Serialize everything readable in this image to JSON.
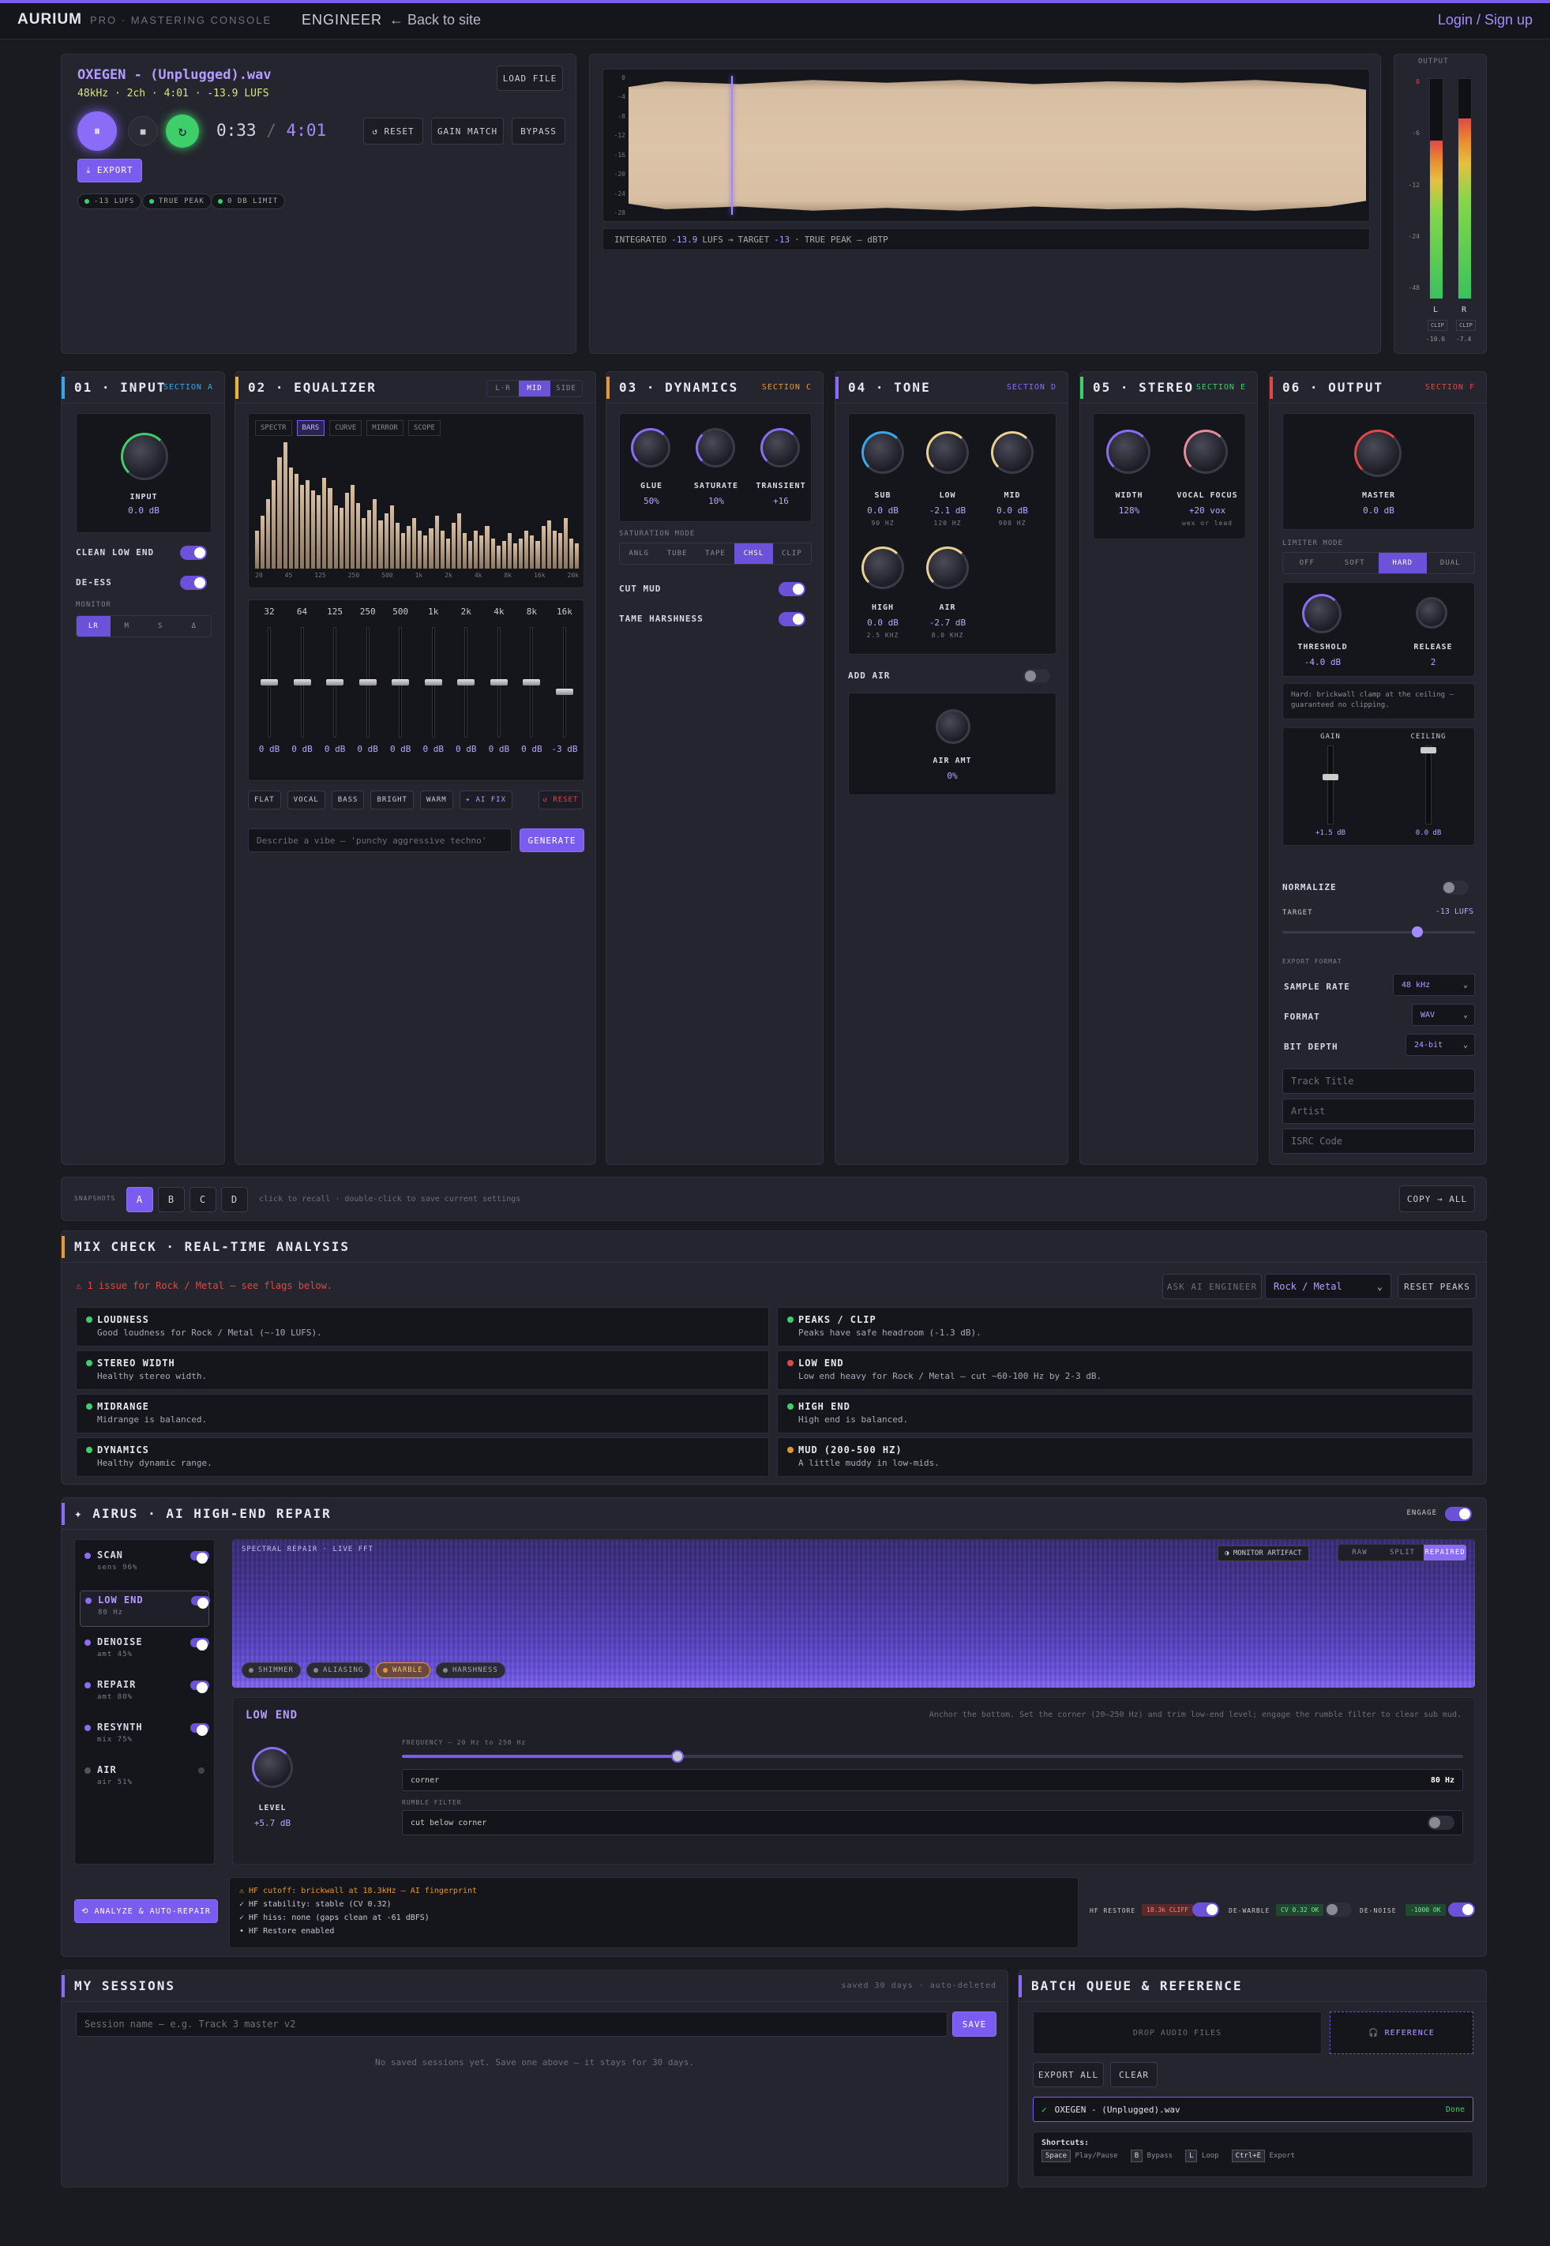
{
  "topbar": {
    "brand": "AURIUM",
    "subtitle": "PRO · MASTERING CONSOLE",
    "mode": "ENGINEER",
    "back": "← Back to site",
    "login": "Login / Sign up"
  },
  "player": {
    "filename": "OXEGEN - (Unplugged).wav",
    "meta": "48kHz · 2ch · 4:01 · -13.9 LUFS",
    "load": "LOAD FILE",
    "time_current": "0:33",
    "time_sep": "/",
    "time_total": "4:01",
    "reset": "↺ RESET",
    "gain_match": "GAIN MATCH",
    "bypass": "BYPASS",
    "export": "⤓ EXPORT",
    "badges": [
      "-13 LUFS",
      "TRUE PEAK",
      "0 DB LIMIT"
    ]
  },
  "waveform": {
    "y_ticks": [
      "0",
      "-4",
      "-8",
      "-12",
      "-16",
      "-20",
      "-24",
      "-28"
    ],
    "integrated_label": "INTEGRATED",
    "integrated": "-13.9",
    "lufs": "LUFS",
    "arrow": "→",
    "target_label": "TARGET",
    "target": "-13",
    "sep": "·",
    "true_peak": "TRUE PEAK — dBTP"
  },
  "meters": {
    "title": "OUTPUT",
    "ticks": [
      "0",
      "-6",
      "-12",
      "-24",
      "-48"
    ],
    "left": "L",
    "right": "R",
    "clip": "CLIP",
    "left_val": "-10.6",
    "right_val": "-7.4",
    "left_level": 0.72,
    "right_level": 0.82
  },
  "input": {
    "title": "01 · INPUT",
    "section": "SECTION A",
    "knob_label": "INPUT",
    "knob_value": "0.0 dB",
    "clean_low_end": "CLEAN LOW END",
    "de_ess": "DE-ESS",
    "monitor": "MONITOR",
    "monitor_opts": [
      "LR",
      "M",
      "S",
      "Δ"
    ]
  },
  "eq": {
    "title": "02 · EQUALIZER",
    "modes": [
      "L·R",
      "MID",
      "SIDE"
    ],
    "views": [
      "SPECTR",
      "BARS",
      "CURVE",
      "MIRROR",
      "SCOPE"
    ],
    "freq_axis": [
      "20",
      "45",
      "125",
      "250",
      "500",
      "1k",
      "2k",
      "4k",
      "8k",
      "16k",
      "20k"
    ],
    "bands": [
      "32",
      "64",
      "125",
      "250",
      "500",
      "1k",
      "2k",
      "4k",
      "8k",
      "16k"
    ],
    "gains": [
      "0 dB",
      "0 dB",
      "0 dB",
      "0 dB",
      "0 dB",
      "0 dB",
      "0 dB",
      "0 dB",
      "0 dB",
      "-3 dB"
    ],
    "presets": [
      "FLAT",
      "VOCAL",
      "BASS",
      "BRIGHT",
      "WARM",
      "✦ AI FIX"
    ],
    "reset": "↺ RESET",
    "vibe_placeholder": "Describe a vibe — 'punchy aggressive techno'",
    "generate": "GENERATE"
  },
  "dynamics": {
    "title": "03 · DYNAMICS",
    "section": "SECTION C",
    "knobs": [
      {
        "label": "GLUE",
        "value": "50%"
      },
      {
        "label": "SATURATE",
        "value": "10%"
      },
      {
        "label": "TRANSIENT",
        "value": "+16"
      }
    ],
    "sat_mode": "SATURATION MODE",
    "sat_opts": [
      "ANLG",
      "TUBE",
      "TAPE",
      "CHSL",
      "CLIP"
    ],
    "cut_mud": "CUT MUD",
    "tame": "TAME HARSHNESS"
  },
  "tone": {
    "title": "04 · TONE",
    "section": "SECTION D",
    "knobs": [
      {
        "label": "SUB",
        "value": "0.0 dB",
        "freq": "90 Hz"
      },
      {
        "label": "LOW",
        "value": "-2.1 dB",
        "freq": "120 Hz"
      },
      {
        "label": "MID",
        "value": "0.0 dB",
        "freq": "900 Hz"
      },
      {
        "label": "HIGH",
        "value": "0.0 dB",
        "freq": "2.5 kHz"
      },
      {
        "label": "AIR",
        "value": "-2.7 dB",
        "freq": "8.0 kHz"
      }
    ],
    "add_air": "ADD AIR",
    "air_amt": "AIR AMT",
    "air_value": "0%"
  },
  "stereo": {
    "title": "05 · STEREO",
    "section": "SECTION E",
    "width_label": "WIDTH",
    "width_value": "128%",
    "vocal_label": "VOCAL FOCUS",
    "vocal_value": "+20 vox",
    "vocal_sub": "wex or lead"
  },
  "output": {
    "title": "06 · OUTPUT",
    "section": "SECTION F",
    "master_label": "MASTER",
    "master_value": "0.0 dB",
    "limiter_mode": "LIMITER MODE",
    "limiter_opts": [
      "OFF",
      "SOFT",
      "HARD",
      "DUAL"
    ],
    "threshold_label": "THRESHOLD",
    "threshold_value": "-4.0 dB",
    "release_label": "RELEASE",
    "release_value": "2",
    "hard_note": "Hard: brickwall clamp at the ceiling — guaranteed no clipping.",
    "gain_label": "GAIN",
    "gain_value": "+1.5 dB",
    "ceiling_label": "CEILING",
    "ceiling_value": "0.0 dB",
    "normalize": "NORMALIZE",
    "target_label": "TARGET",
    "target_value": "-13 LUFS",
    "export_format": "EXPORT FORMAT",
    "sample_rate_label": "SAMPLE RATE",
    "sample_rate": "48 kHz",
    "format_label": "FORMAT",
    "format": "WAV",
    "bit_depth_label": "BIT DEPTH",
    "bit_depth": "24-bit",
    "track_title": "Track Title",
    "artist": "Artist",
    "isrc": "ISRC Code"
  },
  "snapshots": {
    "label": "SNAPSHOTS",
    "slots": [
      "A",
      "B",
      "C",
      "D"
    ],
    "hint": "click to recall · double-click to save current settings",
    "copy": "COPY → ALL"
  },
  "mixcheck": {
    "title": "MIX CHECK · REAL-TIME ANALYSIS",
    "issue": "⚠ 1 issue for Rock / Metal — see flags below.",
    "ask": "ASK AI ENGINEER",
    "genre": "Rock / Metal",
    "reset": "RESET PEAKS",
    "items": [
      {
        "t": "LOUDNESS",
        "d": "Good loudness for Rock / Metal (~-10 LUFS).",
        "c": "#3fcf6a"
      },
      {
        "t": "PEAKS / CLIP",
        "d": "Peaks have safe headroom (-1.3 dB).",
        "c": "#3fcf6a"
      },
      {
        "t": "STEREO WIDTH",
        "d": "Healthy stereo width.",
        "c": "#3fcf6a"
      },
      {
        "t": "LOW END",
        "d": "Low end heavy for Rock / Metal — cut ~60-100 Hz by 2-3 dB.",
        "c": "#e04848"
      },
      {
        "t": "MIDRANGE",
        "d": "Midrange is balanced.",
        "c": "#3fcf6a"
      },
      {
        "t": "HIGH END",
        "d": "High end is balanced.",
        "c": "#3fcf6a"
      },
      {
        "t": "DYNAMICS",
        "d": "Healthy dynamic range.",
        "c": "#3fcf6a"
      },
      {
        "t": "MUD (200-500 HZ)",
        "d": "A little muddy in low-mids.",
        "c": "#e0962e"
      }
    ]
  },
  "airus": {
    "title": "✦ AIRUS · AI HIGH-END REPAIR",
    "engage": "ENGAGE",
    "modules": [
      {
        "name": "SCAN",
        "sub": "sens 96%",
        "on": true
      },
      {
        "name": "LOW END",
        "sub": "80 Hz",
        "on": true
      },
      {
        "name": "DENOISE",
        "sub": "amt 45%",
        "on": true
      },
      {
        "name": "REPAIR",
        "sub": "amt 80%",
        "on": true
      },
      {
        "name": "RESYNTH",
        "sub": "mix 75%",
        "on": true
      },
      {
        "name": "AIR",
        "sub": "air 51%",
        "on": false
      }
    ],
    "spectral": "SPECTRAL REPAIR · live FFT",
    "monitor_artifact": "◑ MONITOR ARTIFACT",
    "views": [
      "RAW",
      "SPLIT",
      "REPAIRED"
    ],
    "tags": [
      "SHIMMER",
      "ALIASING",
      "WARBLE",
      "HARSHNESS"
    ],
    "detail_title": "LOW END",
    "detail_hint": "Anchor the bottom. Set the corner (20–250 Hz) and trim low-end level; engage the rumble filter to clear sub mud.",
    "level_label": "LEVEL",
    "level_value": "+5.7 dB",
    "freq_label": "FREQUENCY — 20 Hz to 250 Hz",
    "slider_fraction": 0.26,
    "corner_label": "corner",
    "corner_value": "80 Hz",
    "rumble_label": "RUMBLE FILTER",
    "rumble_text": "cut below corner",
    "analyze": "⟲ ANALYZE & AUTO-REPAIR",
    "log": [
      "⚠ HF cutoff: brickwall at 18.3kHz — AI fingerprint",
      "✓ HF stability: stable (CV 0.32)",
      "✓ HF hiss: none (gaps clean at -61 dBFS)",
      "• HF Restore enabled"
    ],
    "hf_restore": "HF RESTORE",
    "hf_badge": "18.3k CLIFF",
    "de_warble": "DE-WARBLE",
    "dw_badge": "CV 0.32 OK",
    "de_noise": "DE-NOISE",
    "dn_badge": "-1000 OK"
  },
  "sessions": {
    "title": "MY SESSIONS",
    "note": "saved 30 days · auto-deleted",
    "placeholder": "Session name — e.g. Track 3 master v2",
    "save": "SAVE",
    "empty": "No saved sessions yet. Save one above — it stays for 30 days."
  },
  "batch": {
    "title": "BATCH QUEUE & REFERENCE",
    "drop": "DROP AUDIO FILES",
    "reference": "🎧 REFERENCE",
    "export_all": "EXPORT ALL",
    "clear": "CLEAR",
    "file_check": "✓",
    "file": "OXEGEN - (Unplugged).wav",
    "file_status": "Done",
    "shortcuts_title": "Shortcuts:",
    "shortcuts": [
      {
        "k": "Space",
        "v": "Play/Pause"
      },
      {
        "k": "B",
        "v": "Bypass"
      },
      {
        "k": "L",
        "v": "Loop"
      },
      {
        "k": "Ctrl+E",
        "v": "Export"
      }
    ]
  }
}
